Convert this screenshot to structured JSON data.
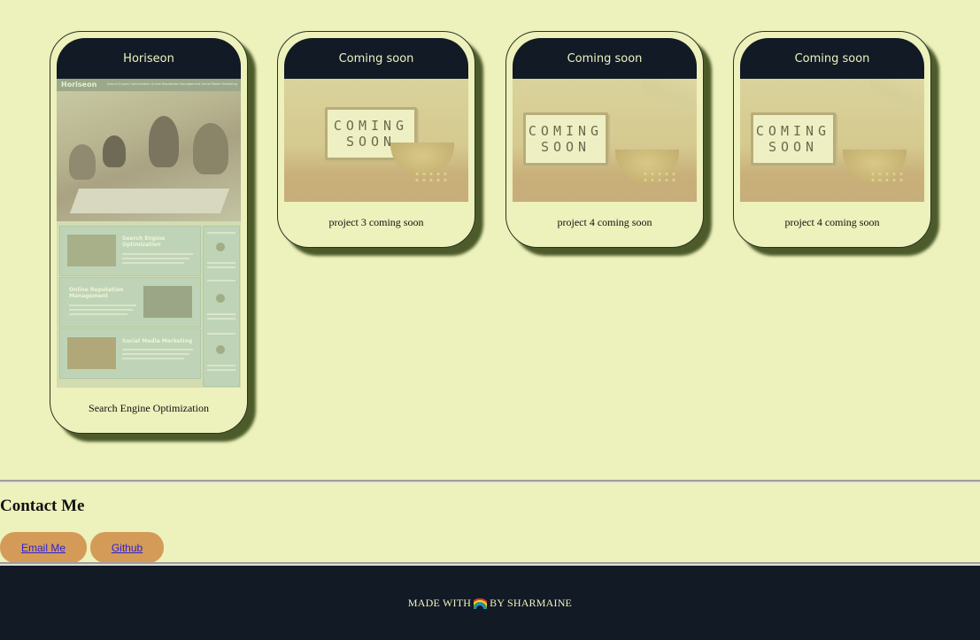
{
  "projects": [
    {
      "title": "Horiseon",
      "caption": "Search Engine Optimization",
      "image": "horiseon-screenshot"
    },
    {
      "title": "Coming soon",
      "caption": "project 3 coming soon",
      "image": "coming-soon"
    },
    {
      "title": "Coming soon",
      "caption": "project 4 coming soon",
      "image": "coming-soon"
    },
    {
      "title": "Coming soon",
      "caption": "project 4 coming soon",
      "image": "coming-soon"
    }
  ],
  "horiseon_shot": {
    "logo": "Horiseon",
    "nav": "Search Engine Optimization   Online Reputation Management   Social Media Marketing",
    "services": [
      "Search Engine Optimization",
      "Online Reputation Management",
      "Social Media Marketing"
    ]
  },
  "coming_soon_sign": {
    "line1": "COMING",
    "line2": "SOON"
  },
  "contact": {
    "title": "Contact Me",
    "email_label": "Email Me",
    "github_label": "Github"
  },
  "footer": {
    "before": "MADE WITH",
    "after": "BY SHARMAINE",
    "icon": "rainbow-icon"
  },
  "colors": {
    "page_background": "#edf1bb",
    "dark_navy": "#121a25",
    "button": "#d49b58",
    "shadow": "#4d5b2b"
  }
}
